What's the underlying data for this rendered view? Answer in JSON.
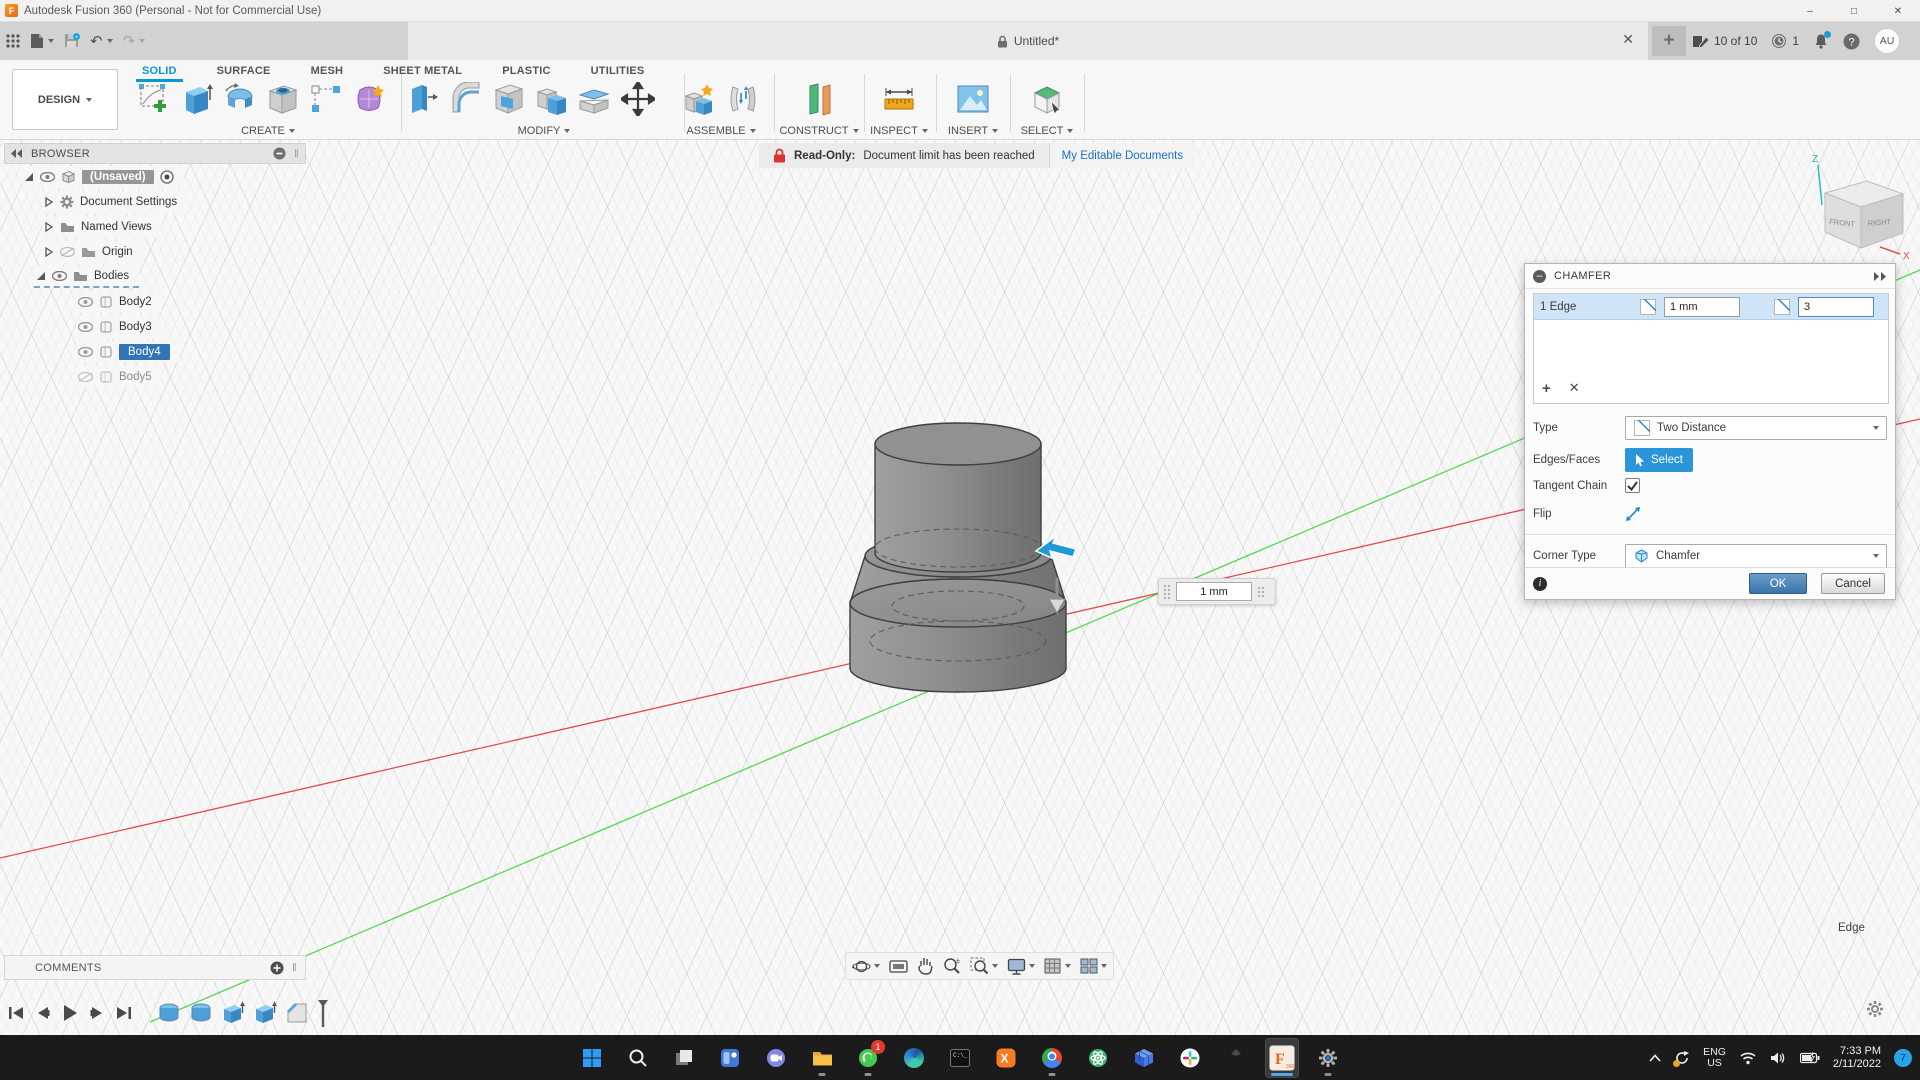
{
  "title_bar": {
    "title": "Autodesk Fusion 360 (Personal - Not for Commercial Use)"
  },
  "tab_bar": {
    "document_tab": "Untitled*",
    "documents_count": "10 of 10",
    "notifications_count": "1",
    "avatar": "AU"
  },
  "ribbon": {
    "design_menu": "DESIGN",
    "tabs": [
      {
        "label": "SOLID"
      },
      {
        "label": "SURFACE"
      },
      {
        "label": "MESH"
      },
      {
        "label": "SHEET METAL"
      },
      {
        "label": "PLASTIC"
      },
      {
        "label": "UTILITIES"
      }
    ],
    "groups": [
      "CREATE",
      "MODIFY",
      "ASSEMBLE",
      "CONSTRUCT",
      "INSPECT",
      "INSERT",
      "SELECT"
    ]
  },
  "banner": {
    "label": "Read-Only:",
    "message": "Document limit has been reached",
    "link": "My Editable Documents"
  },
  "browser": {
    "header": "BROWSER",
    "items": [
      {
        "label": "(Unsaved)"
      },
      {
        "label": "Document Settings"
      },
      {
        "label": "Named Views"
      },
      {
        "label": "Origin"
      },
      {
        "label": "Bodies"
      },
      {
        "label": "Body2"
      },
      {
        "label": "Body3"
      },
      {
        "label": "Body4"
      },
      {
        "label": "Body5"
      }
    ]
  },
  "chamfer_dialog": {
    "title": "CHAMFER",
    "selection_row": {
      "label": "1 Edge",
      "distance_1": "1 mm",
      "distance_2": "3"
    },
    "type_label": "Type",
    "type_value": "Two Distance",
    "edges_label": "Edges/Faces",
    "edges_button": "Select",
    "tangent_label": "Tangent Chain",
    "flip_label": "Flip",
    "corner_label": "Corner Type",
    "corner_value": "Chamfer",
    "ok": "OK",
    "cancel": "Cancel"
  },
  "viewport": {
    "dimension_input": "1 mm",
    "selection_status": "Edge",
    "viewcube": {
      "front_label": "FRONT",
      "right_label": "RIGHT",
      "z_label": "Z",
      "x_label": "X"
    }
  },
  "comments_bar": {
    "label": "COMMENTS"
  },
  "taskbar": {
    "language_top": "ENG",
    "language_bottom": "US",
    "time": "7:33 PM",
    "date": "2/11/2022",
    "badge_count": "7",
    "whatsapp_badge": "1"
  }
}
